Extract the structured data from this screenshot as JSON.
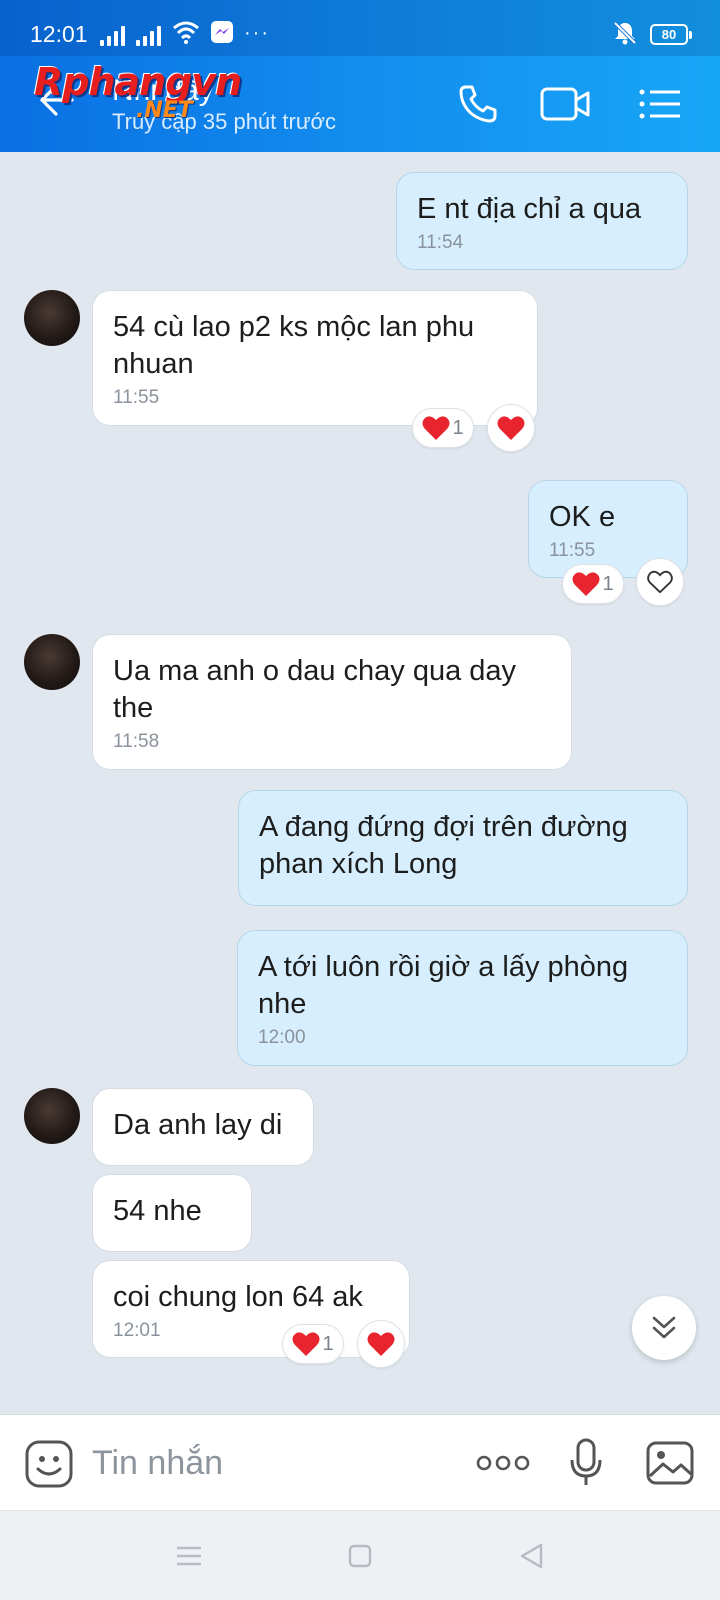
{
  "status_bar": {
    "time": "12:01",
    "battery": "80",
    "more": "···"
  },
  "header": {
    "contact_name": "Nhi đây",
    "contact_status": "Truy cập 35 phút trước",
    "watermark": "Rphangvn",
    "watermark_suffix": ".NET"
  },
  "messages": [
    {
      "dir": "out",
      "text": "E nt địa chỉ a qua",
      "time": "11:54"
    },
    {
      "dir": "in",
      "text": "54 cù lao p2 ks mộc lan phu nhuan",
      "time": "11:55",
      "reaction_count": "1"
    },
    {
      "dir": "out",
      "text": "OK e",
      "time": "11:55",
      "reaction_count": "1"
    },
    {
      "dir": "in",
      "text": "Ua ma anh o dau chay qua day the",
      "time": "11:58"
    },
    {
      "dir": "out",
      "text": "A đang đứng đợi trên đường phan xích Long"
    },
    {
      "dir": "out",
      "text": "A tới luôn rồi giờ a lấy phòng nhe",
      "time": "12:00"
    },
    {
      "dir": "in",
      "text": "Da anh lay di"
    },
    {
      "dir": "in",
      "text": "54 nhe"
    },
    {
      "dir": "in",
      "text": "coi chung lon 64 ak",
      "time": "12:01",
      "reaction_count": "1"
    }
  ],
  "input": {
    "placeholder": "Tin nhắn",
    "more": "ooo"
  },
  "colors": {
    "header_start": "#0a6fe3",
    "header_end": "#17a6f6",
    "outgoing_bubble": "#d6eefd",
    "chat_bg": "#e1e7ef",
    "heart": "#e8252e"
  }
}
